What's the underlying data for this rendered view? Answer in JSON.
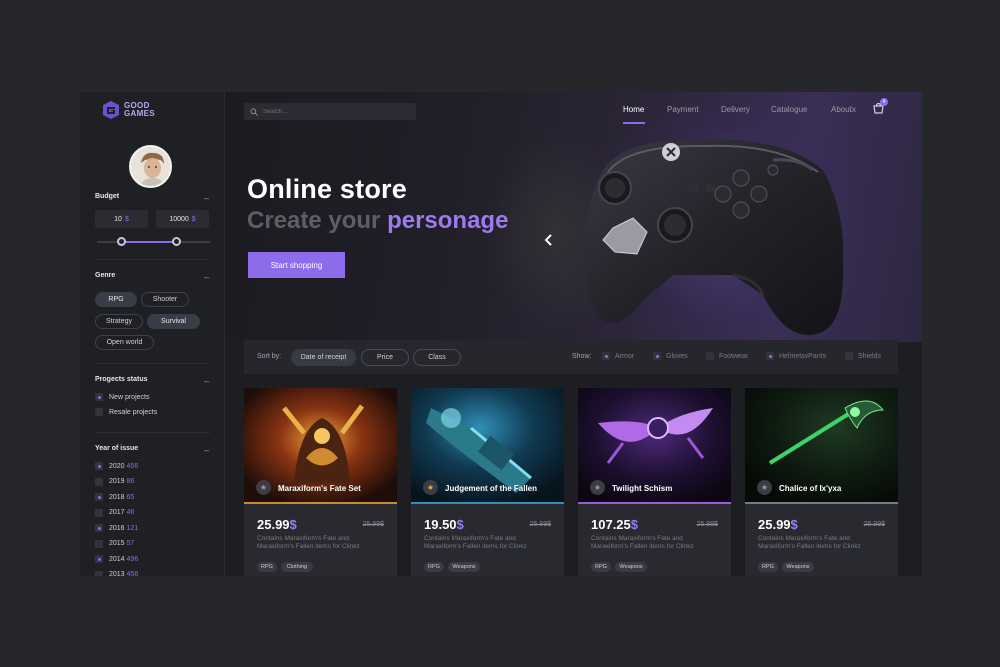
{
  "brand": {
    "name_line1": "GOOD",
    "name_line2": "GAMES",
    "accent": "#8e6bea"
  },
  "sidebar": {
    "budget": {
      "title": "Budget",
      "min": "10",
      "max": "10000",
      "currency": "$",
      "range_fraction": [
        0.22,
        0.7
      ]
    },
    "genre": {
      "title": "Genre",
      "chips": [
        {
          "label": "RPG",
          "active": true
        },
        {
          "label": "Shooter",
          "active": false
        },
        {
          "label": "Strategy",
          "active": false
        },
        {
          "label": "Survival",
          "active": true
        },
        {
          "label": "Open world",
          "active": false
        }
      ]
    },
    "projects_status": {
      "title": "Progects status",
      "items": [
        {
          "label": "New projects",
          "checked": true
        },
        {
          "label": "Resale projects",
          "checked": false
        }
      ]
    },
    "year_of_issue": {
      "title": "Year of issue",
      "items": [
        {
          "year": "2020",
          "count": "456",
          "checked": true
        },
        {
          "year": "2019",
          "count": "86",
          "checked": false
        },
        {
          "year": "2018",
          "count": "65",
          "checked": true
        },
        {
          "year": "2017",
          "count": "46",
          "checked": false
        },
        {
          "year": "2016",
          "count": "121",
          "checked": true
        },
        {
          "year": "2015",
          "count": "57",
          "checked": false
        },
        {
          "year": "2014",
          "count": "496",
          "checked": true
        },
        {
          "year": "2013",
          "count": "456",
          "checked": false
        }
      ]
    }
  },
  "header": {
    "search_placeholder": "Search...",
    "nav": [
      {
        "label": "Home",
        "active": true
      },
      {
        "label": "Payment",
        "active": false
      },
      {
        "label": "Delivery",
        "active": false
      },
      {
        "label": "Catalogue",
        "active": false
      },
      {
        "label": "Aboutx",
        "active": false
      }
    ],
    "cart_count": "4"
  },
  "hero": {
    "title": "Online store",
    "subtitle_plain": "Create your ",
    "subtitle_accent": "personage",
    "cta": "Start shopping"
  },
  "filter": {
    "sort_label": "Sort by:",
    "sort_options": [
      {
        "label": "Date of receipt",
        "active": true
      },
      {
        "label": "Price",
        "active": false
      },
      {
        "label": "Class",
        "active": false
      }
    ],
    "show_label": "Show:",
    "show_options": [
      {
        "label": "Armor",
        "checked": true
      },
      {
        "label": "Gloves",
        "checked": true
      },
      {
        "label": "Footwear",
        "checked": false
      },
      {
        "label": "HelmetsvPants",
        "checked": true
      },
      {
        "label": "Shields",
        "checked": false
      }
    ]
  },
  "products": [
    {
      "name": "Maraxiform's Fate Set",
      "price": "25.99",
      "currency": "$",
      "old_price": "25.99$",
      "desc": "Contains Maraxiform's Fate and Maraxiform's Fallen items for Clinkz",
      "tags": [
        "RPG",
        "Clothing"
      ],
      "star": "gray",
      "line_color": "#c98a2d"
    },
    {
      "name": "Judgement of the Fallen",
      "price": "19.50",
      "currency": "$",
      "old_price": "25.99$",
      "desc": "Contains Maraxiform's Fate and Maraxiform's Fallen items for Clinkz",
      "tags": [
        "RPG",
        "Weapons"
      ],
      "star": "gold",
      "line_color": "#2e8fb8"
    },
    {
      "name": "Twilight Schism",
      "price": "107.25",
      "currency": "$",
      "old_price": "25.99$",
      "desc": "Contains Maraxiform's Fate and Maraxiform's Fallen items for Clinkz",
      "tags": [
        "RPG",
        "Weapons"
      ],
      "star": "gray",
      "line_color": "#a05ad8"
    },
    {
      "name": "Chalice of Ix'yxa",
      "price": "25.99",
      "currency": "$",
      "old_price": "25.99$",
      "desc": "Contains Maraxiform's Fate and Maraxiform's Fallen items for Clinkz",
      "tags": [
        "RPG",
        "Weapons"
      ],
      "star": "gray",
      "line_color": "#7a7a85"
    }
  ]
}
